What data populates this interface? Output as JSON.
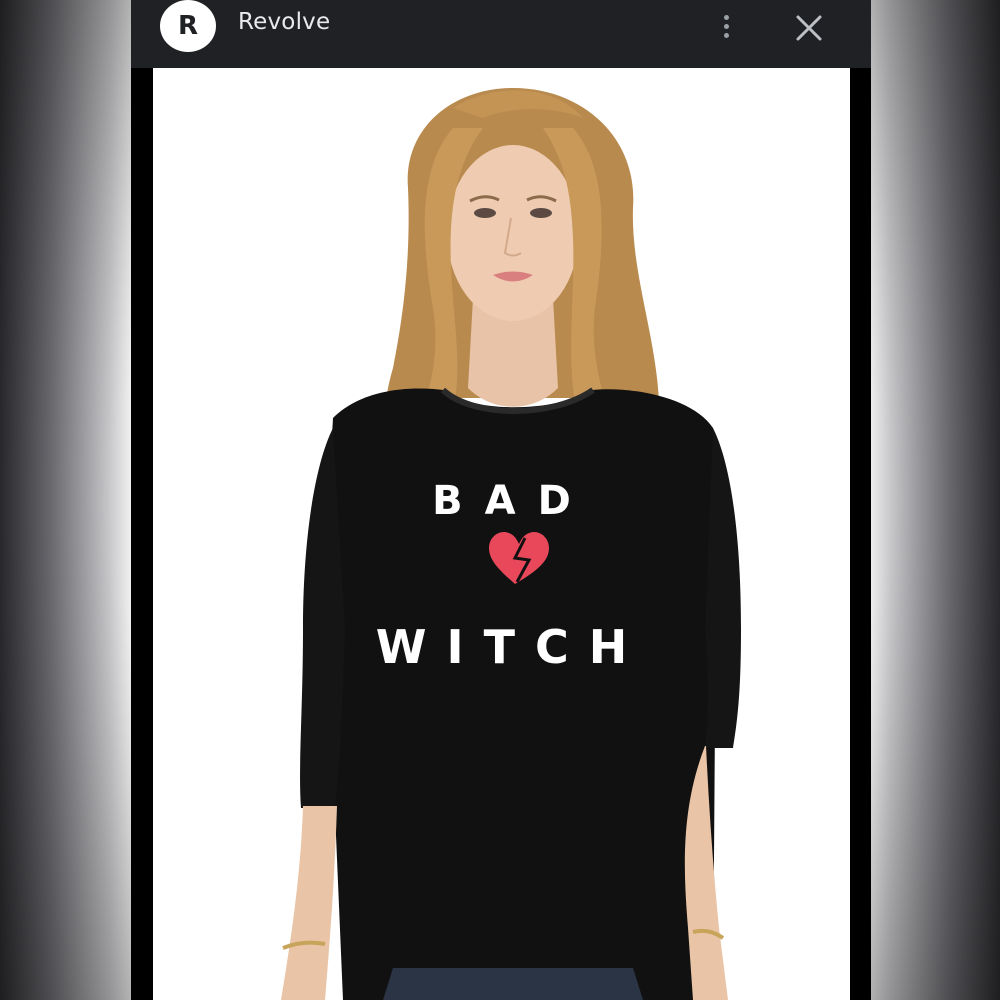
{
  "app": {
    "badge_letter": "R",
    "title": "Revolve"
  },
  "icons": {
    "menu": "more-vert-icon",
    "close": "close-icon"
  },
  "product_image": {
    "shirt_line_1": "BAD",
    "shirt_line_2": "WITCH",
    "heart_color": "#e8485a",
    "shirt_color": "#111111"
  },
  "colors": {
    "topbar": "#202124",
    "frame": "#000000"
  }
}
